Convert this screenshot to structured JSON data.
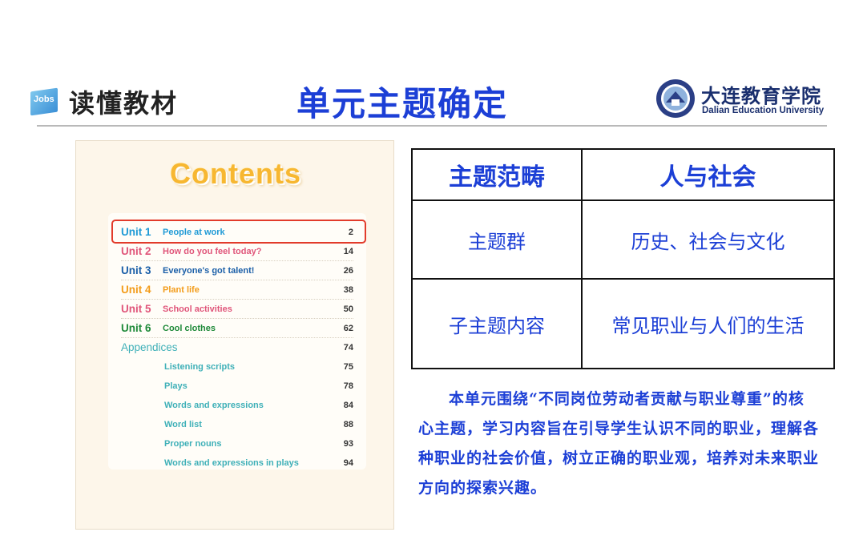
{
  "header": {
    "logo_text": "Jobs",
    "brand_title": "读懂教材",
    "page_title": "单元主题确定",
    "university_cn": "大连教育学院",
    "university_en": "Dalian Education University"
  },
  "textbook": {
    "contents_title": "Contents",
    "units": [
      {
        "unit": "Unit 1",
        "name": "People at work",
        "page": "2",
        "color": "#1f9ad6"
      },
      {
        "unit": "Unit 2",
        "name": "How do you feel today?",
        "page": "14",
        "color": "#e0557a"
      },
      {
        "unit": "Unit 3",
        "name": "Everyone's got talent!",
        "page": "26",
        "color": "#1b5fa8"
      },
      {
        "unit": "Unit 4",
        "name": "Plant life",
        "page": "38",
        "color": "#f39c1a"
      },
      {
        "unit": "Unit 5",
        "name": "School activities",
        "page": "50",
        "color": "#e0557a"
      },
      {
        "unit": "Unit 6",
        "name": "Cool clothes",
        "page": "62",
        "color": "#1f8a3a"
      }
    ],
    "appendices": {
      "name": "Appendices",
      "page": "74"
    },
    "sub_items": [
      {
        "name": "Listening scripts",
        "page": "75"
      },
      {
        "name": "Plays",
        "page": "78"
      },
      {
        "name": "Words and expressions",
        "page": "84"
      },
      {
        "name": "Word list",
        "page": "88"
      },
      {
        "name": "Proper nouns",
        "page": "93"
      },
      {
        "name": "Words and expressions in plays",
        "page": "94"
      }
    ]
  },
  "theme_table": {
    "header_left": "主题范畴",
    "header_right": "人与社会",
    "rows": [
      {
        "left": "主题群",
        "right": "历史、社会与文化"
      },
      {
        "left": "子主题内容",
        "right": "常见职业与人们的生活"
      }
    ]
  },
  "description": "本单元围绕“不同岗位劳动者贡献与职业尊重”的核心主题，学习内容旨在引导学生认识不同的职业，理解各种职业的社会价值，树立正确的职业观，培养对未来职业方向的探索兴趣。",
  "colors": {
    "accent_blue": "#1c3fd6",
    "highlight_red": "#e23b2b",
    "contents_yellow": "#f7b731"
  }
}
